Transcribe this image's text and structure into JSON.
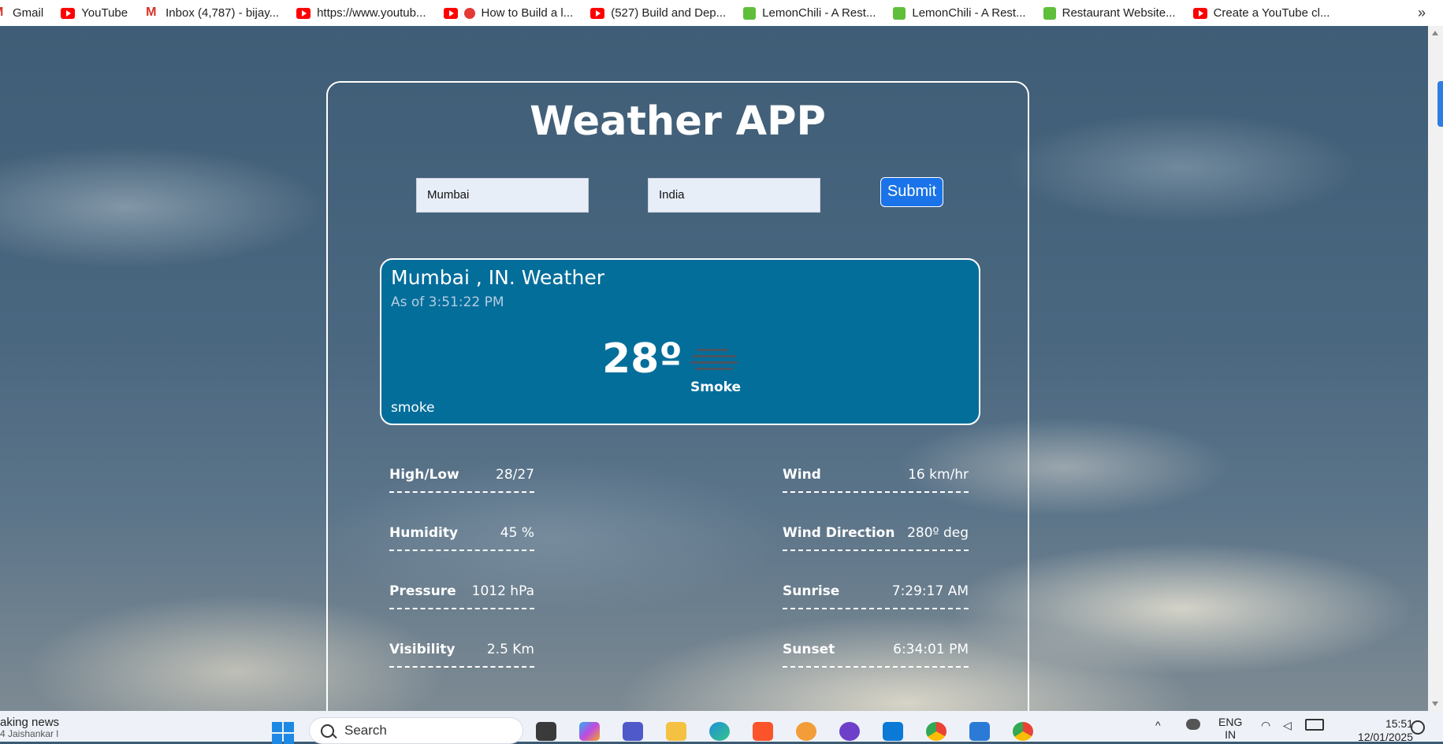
{
  "bookmarks": [
    {
      "label": "Gmail",
      "icon": "gmail-icon"
    },
    {
      "label": "YouTube",
      "icon": "youtube-icon"
    },
    {
      "label": "Inbox (4,787) - bijay...",
      "icon": "gmail-icon"
    },
    {
      "label": "https://www.youtub...",
      "icon": "youtube-icon"
    },
    {
      "label": "How to Build a l...",
      "icon": "youtube-icon"
    },
    {
      "label": "(527) Build and Dep...",
      "icon": "youtube-icon"
    },
    {
      "label": "LemonChili - A Rest...",
      "icon": "lemonchili-icon"
    },
    {
      "label": "LemonChili - A Rest...",
      "icon": "lemonchili-icon"
    },
    {
      "label": "Restaurant Website...",
      "icon": "lemonchili-icon"
    },
    {
      "label": "Create a YouTube cl...",
      "icon": "youtube-icon"
    }
  ],
  "app": {
    "title": "Weather APP",
    "city_value": "Mumbai",
    "country_value": "India",
    "submit_label": "Submit"
  },
  "current": {
    "heading": "Mumbai , IN. Weather",
    "as_of": "As of 3:51:22 PM",
    "temperature": "28º",
    "condition": "Smoke",
    "description": "smoke",
    "icon": "smoke-icon"
  },
  "details": {
    "left": [
      {
        "label": "High/Low",
        "value": "28/27"
      },
      {
        "label": "Humidity",
        "value": "45 %"
      },
      {
        "label": "Pressure",
        "value": "1012 hPa"
      },
      {
        "label": "Visibility",
        "value": "2.5 Km"
      }
    ],
    "right": [
      {
        "label": "Wind",
        "value": "16 km/hr"
      },
      {
        "label": "Wind Direction",
        "value": "280º deg"
      },
      {
        "label": "Sunrise",
        "value": "7:29:17 AM"
      },
      {
        "label": "Sunset",
        "value": "6:34:01 PM"
      }
    ]
  },
  "taskbar": {
    "news_title": "aking news",
    "news_sub": "4 Jaishankar l",
    "search_placeholder": "Search",
    "language": "ENG",
    "region": "IN",
    "time": "15:51",
    "date": "12/01/2025"
  },
  "colors": {
    "card_bg": "#046e9b",
    "submit_bg": "#1a73e8",
    "accent_text": "#ffffff"
  }
}
